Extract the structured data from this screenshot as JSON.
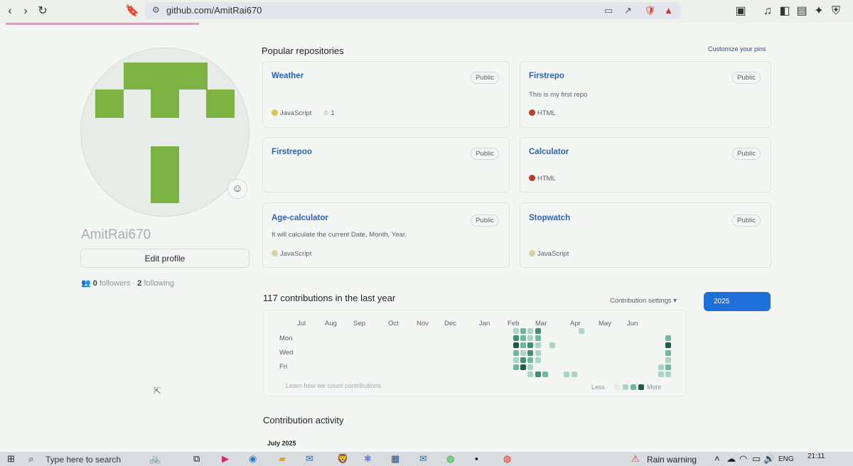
{
  "browser": {
    "url": "github.com/AmitRai670"
  },
  "profile": {
    "username": "AmitRai670",
    "edit_label": "Edit profile",
    "followers_count": "0",
    "followers_label": "followers",
    "sep": "·",
    "following_count": "2",
    "following_label": "following"
  },
  "popular": {
    "title": "Popular repositories",
    "customize": "Customize your pins",
    "repos": [
      {
        "name": "Weather",
        "badge": "Public",
        "desc": "",
        "lang": "JavaScript",
        "lang_color": "#d9c64f",
        "stars": "1"
      },
      {
        "name": "Firstrepo",
        "badge": "Public",
        "desc": "This is my first repo",
        "lang": "HTML",
        "lang_color": "#b5412a",
        "stars": ""
      },
      {
        "name": "Firstrepoo",
        "badge": "Public",
        "desc": "",
        "lang": "",
        "lang_color": "",
        "stars": ""
      },
      {
        "name": "Calculator",
        "badge": "Public",
        "desc": "",
        "lang": "HTML",
        "lang_color": "#b5412a",
        "stars": ""
      },
      {
        "name": "Age-calculator",
        "badge": "Public",
        "desc": "It will calculate the current Date, Month, Year.",
        "lang": "JavaScript",
        "lang_color": "#d9d3a0",
        "stars": ""
      },
      {
        "name": "Stopwatch",
        "badge": "Public",
        "desc": "",
        "lang": "JavaScript",
        "lang_color": "#d9d3a0",
        "stars": ""
      }
    ]
  },
  "contributions": {
    "title": "117 contributions in the last year",
    "settings": "Contribution settings",
    "year": "2025",
    "months": [
      "Jul",
      "Aug",
      "Sep",
      "Oct",
      "Nov",
      "Dec",
      "Jan",
      "Feb",
      "Mar",
      "Apr",
      "May",
      "Jun"
    ],
    "days": [
      "Mon",
      "Wed",
      "Fri"
    ],
    "learn": "Learn how we count contributions",
    "less": "Less",
    "more": "More",
    "colors": [
      "#e7ebe9",
      "#a8d5c4",
      "#6fb8a0",
      "#3f8f76",
      "#1d5c48"
    ]
  },
  "activity": {
    "title": "Contribution activity",
    "month": "July 2025"
  },
  "taskbar": {
    "search_placeholder": "Type here to search",
    "weather": "Rain warning",
    "lang": "ENG",
    "time": "21:11"
  }
}
